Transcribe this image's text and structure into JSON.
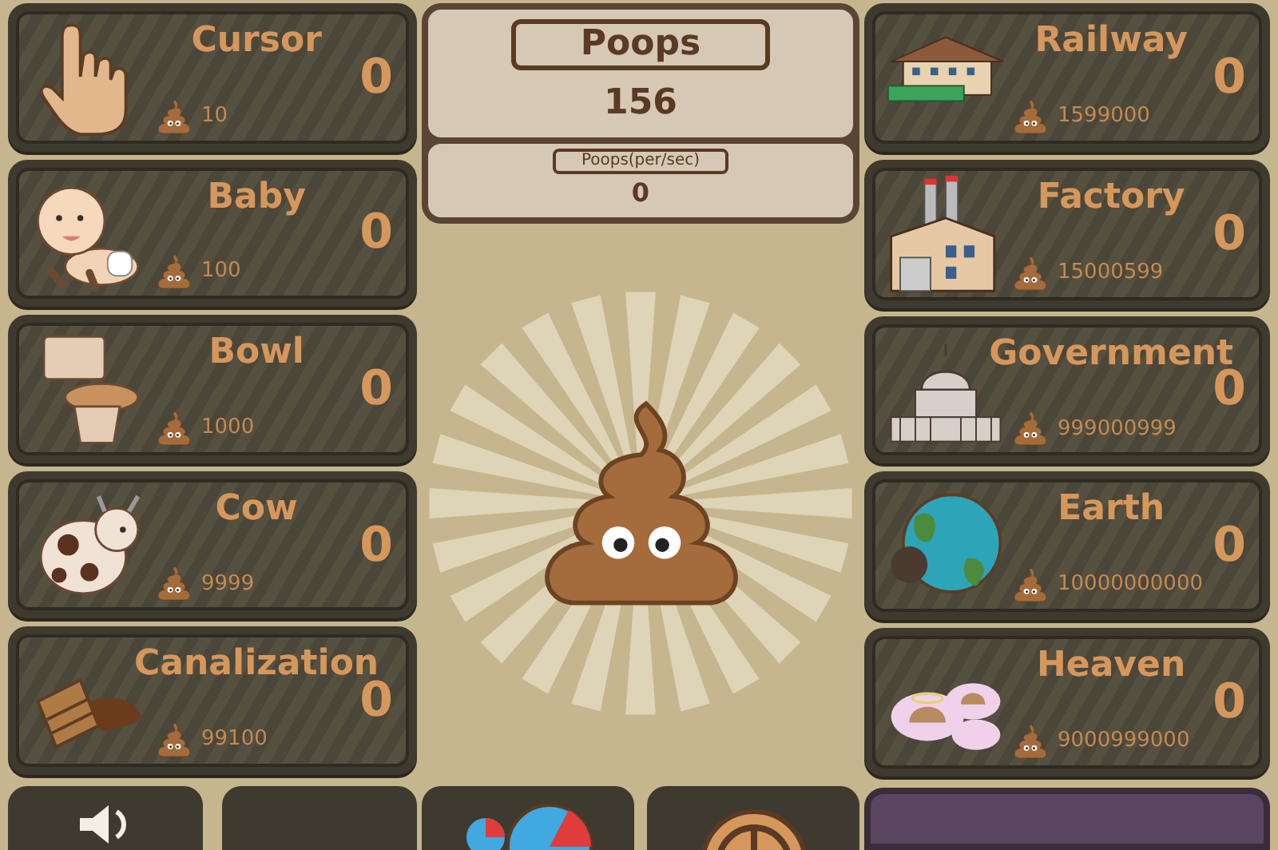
{
  "left_upgrades": [
    {
      "name": "Cursor",
      "cost": "10",
      "count": "0"
    },
    {
      "name": "Baby",
      "cost": "100",
      "count": "0"
    },
    {
      "name": "Bowl",
      "cost": "1000",
      "count": "0"
    },
    {
      "name": "Cow",
      "cost": "9999",
      "count": "0"
    },
    {
      "name": "Canalization",
      "cost": "99100",
      "count": "0"
    }
  ],
  "stats": {
    "title": "Poops",
    "total": "156",
    "rate_label": "Poops(per/sec)",
    "rate": "0"
  },
  "right_upgrades": [
    {
      "name": "Railway",
      "cost": "1599000",
      "count": "0"
    },
    {
      "name": "Factory",
      "cost": "15000599",
      "count": "0"
    },
    {
      "name": "Government",
      "cost": "999000999",
      "count": "0"
    },
    {
      "name": "Earth",
      "cost": "10000000000",
      "count": "0"
    },
    {
      "name": "Heaven",
      "cost": "9000999000",
      "count": "0"
    }
  ]
}
